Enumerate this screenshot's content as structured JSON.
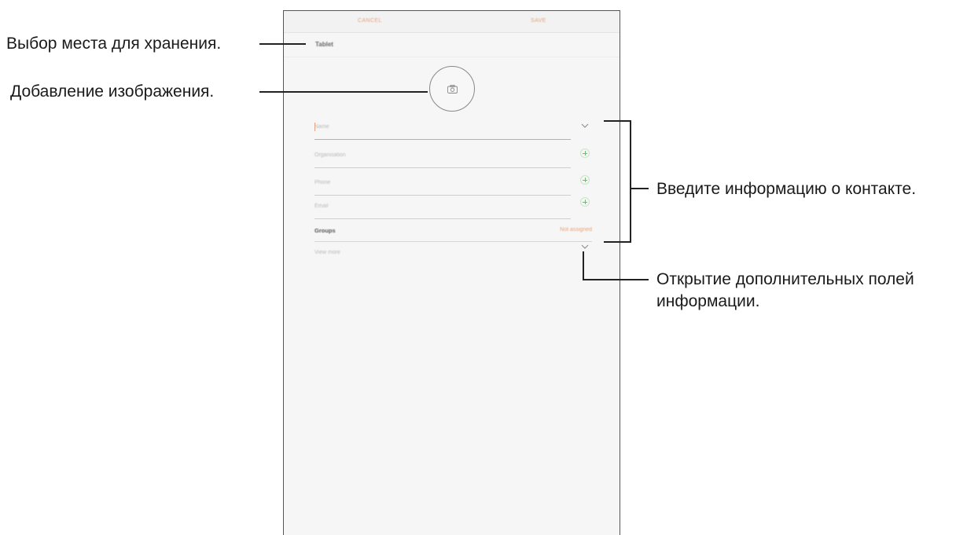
{
  "screen": {
    "topbar": {
      "cancel_label": "CANCEL",
      "save_label": "SAVE"
    },
    "storage_location": "Tablet",
    "fields": {
      "name_placeholder": "Name",
      "organisation_placeholder": "Organisation",
      "phone_placeholder": "Phone",
      "email_placeholder": "Email"
    },
    "groups": {
      "label": "Groups",
      "value": "Not assigned"
    },
    "view_more_label": "View more"
  },
  "callouts": {
    "storage": "Выбор места для хранения.",
    "image": "Добавление изображения.",
    "contact_info": "Введите информацию о контакте.",
    "more_fields": "Открытие дополнительных полей информации."
  },
  "colors": {
    "accent": "#e8a27a",
    "add_icon": "#6cbf6c",
    "screen_bg": "#f6f6f6"
  },
  "icons": {
    "photo": "camera-icon",
    "expand": "chevron-down-icon",
    "add": "plus-icon"
  }
}
